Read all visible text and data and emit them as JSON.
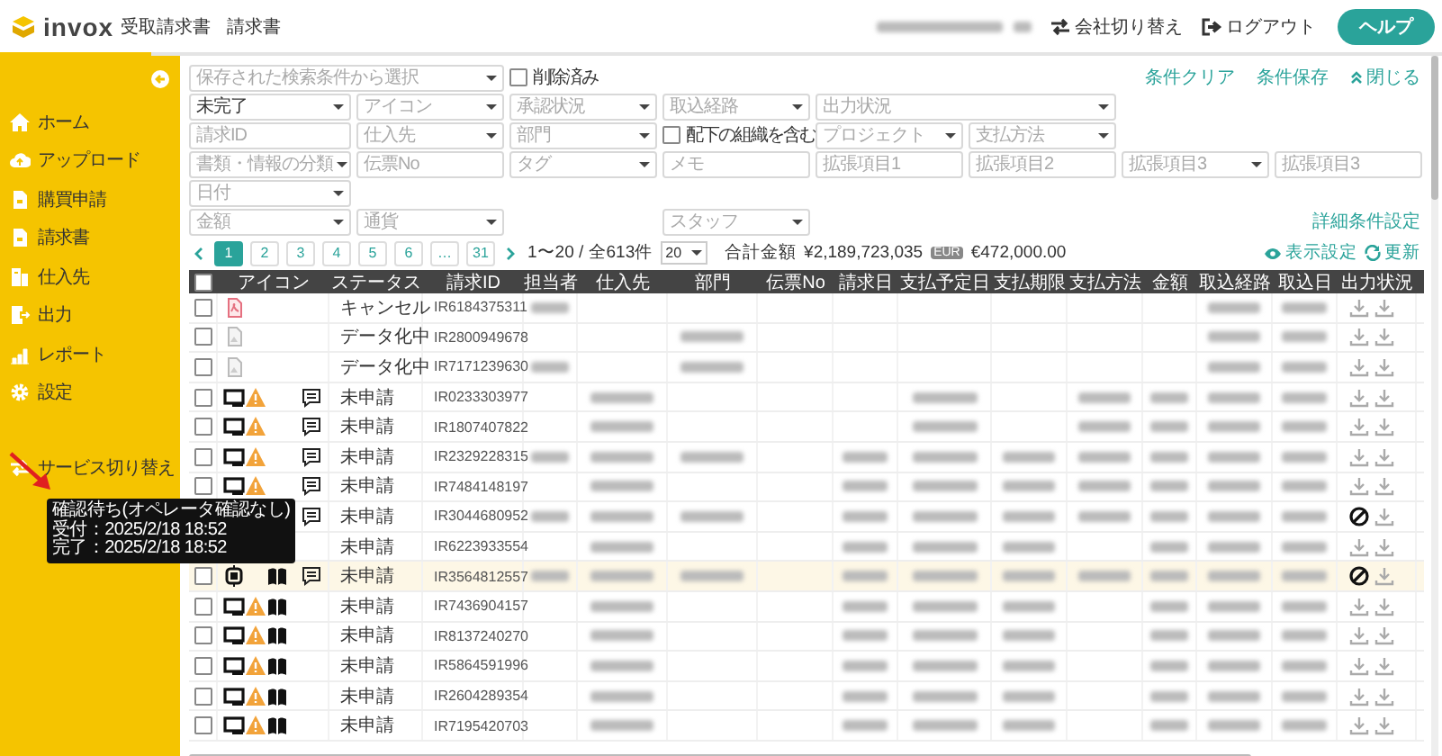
{
  "header": {
    "logo": "invox",
    "product": "受取請求書",
    "breadcrumb": "請求書",
    "actions": [
      {
        "kind": "switch",
        "label": "会社切り替え"
      },
      {
        "kind": "logout",
        "label": "ログアウト"
      }
    ],
    "help": "ヘルプ"
  },
  "sidebar": {
    "items": [
      {
        "kind": "home",
        "label": "ホーム"
      },
      {
        "kind": "upload",
        "label": "アップロード"
      },
      {
        "kind": "doc",
        "label": "購買申請"
      },
      {
        "kind": "doc",
        "label": "請求書"
      },
      {
        "kind": "building",
        "label": "仕入先"
      },
      {
        "kind": "export",
        "label": "出力"
      },
      {
        "kind": "chart",
        "label": "レポート"
      },
      {
        "kind": "gear",
        "label": "設定"
      },
      {
        "kind": "switch",
        "label": "サービス切り替え"
      }
    ]
  },
  "filters": {
    "rows": [
      [
        {
          "kind": "select",
          "placeholder": "保存された検索条件から選択"
        },
        {
          "kind": "checkbox",
          "label": "削除済み",
          "checked": false
        }
      ],
      [
        {
          "kind": "select",
          "value": "未完了"
        },
        {
          "kind": "select",
          "placeholder": "アイコン"
        },
        {
          "kind": "select",
          "placeholder": "承認状況"
        },
        {
          "kind": "select",
          "placeholder": "取込経路"
        },
        {
          "kind": "select",
          "placeholder": "出力状況"
        }
      ],
      [
        {
          "kind": "input",
          "placeholder": "請求ID"
        },
        {
          "kind": "select",
          "placeholder": "仕入先"
        },
        {
          "kind": "select",
          "placeholder": "部門"
        },
        {
          "kind": "checkbox",
          "label": "配下の組織を含む",
          "checked": false
        },
        {
          "kind": "select",
          "placeholder": "プロジェクト"
        },
        {
          "kind": "select",
          "placeholder": "支払方法"
        }
      ],
      [
        {
          "kind": "select",
          "placeholder": "書類・情報の分類"
        },
        {
          "kind": "input",
          "placeholder": "伝票No"
        },
        {
          "kind": "select",
          "placeholder": "タグ"
        },
        {
          "kind": "input",
          "placeholder": "メモ"
        },
        {
          "kind": "input",
          "placeholder": "拡張項目1"
        },
        {
          "kind": "input",
          "placeholder": "拡張項目2"
        },
        {
          "kind": "select",
          "placeholder": "拡張項目3"
        },
        {
          "kind": "input",
          "placeholder": "拡張項目3"
        }
      ],
      [
        {
          "kind": "select",
          "placeholder": "日付"
        }
      ],
      [
        {
          "kind": "select",
          "placeholder": "金額"
        },
        {
          "kind": "select",
          "placeholder": "通貨"
        },
        "",
        {
          "kind": "select",
          "placeholder": "スタッフ"
        }
      ]
    ],
    "links": [
      "条件クリア",
      "条件保存",
      "閉じる"
    ],
    "advanced_link": "詳細条件設定"
  },
  "pagination": {
    "pages": [
      {
        "label": "1",
        "selected": true
      },
      {
        "label": "2",
        "selected": false
      },
      {
        "label": "3",
        "selected": false
      },
      {
        "label": "4",
        "selected": false
      },
      {
        "label": "5",
        "selected": false
      },
      {
        "label": "6",
        "selected": false
      },
      {
        "label": "…",
        "selected": false
      },
      {
        "label": "31",
        "selected": false
      }
    ],
    "range": "1〜20 / 全613件",
    "per_page": "20",
    "total_label": "合計金額",
    "total": "¥2,189,723,035",
    "currency_badge": "EUR",
    "foreign_total": "€472,000.00",
    "display_settings": "表示設定",
    "refresh": "更新"
  },
  "table": {
    "columns": [
      "アイコン",
      "ステータス",
      "請求ID",
      "担当者",
      "仕入先",
      "部門",
      "伝票No",
      "請求日",
      "支払予定日",
      "支払期限",
      "支払方法",
      "金額",
      "取込経路",
      "取込日",
      "出力状況"
    ],
    "all_checked": false,
    "rows": [
      {
        "checked": false,
        "selected": false,
        "kind": "pdf",
        "warning": false,
        "book": false,
        "comment": false,
        "status": "キャンセル",
        "id": "IR6184375311",
        "export_blocked": false
      },
      {
        "checked": false,
        "selected": false,
        "kind": "image",
        "warning": false,
        "book": false,
        "comment": false,
        "status": "データ化中",
        "id": "IR2800949678",
        "export_blocked": false
      },
      {
        "checked": false,
        "selected": false,
        "kind": "image",
        "warning": false,
        "book": false,
        "comment": false,
        "status": "データ化中",
        "id": "IR7171239630",
        "export_blocked": false
      },
      {
        "checked": false,
        "selected": false,
        "kind": "monitor",
        "warning": true,
        "book": false,
        "comment": true,
        "status": "未申請",
        "id": "IR0233303977",
        "export_blocked": false
      },
      {
        "checked": false,
        "selected": false,
        "kind": "monitor",
        "warning": true,
        "book": false,
        "comment": true,
        "status": "未申請",
        "id": "IR1807407822",
        "export_blocked": false
      },
      {
        "checked": false,
        "selected": false,
        "kind": "monitor",
        "warning": true,
        "book": false,
        "comment": true,
        "status": "未申請",
        "id": "IR2329228315",
        "export_blocked": false
      },
      {
        "checked": false,
        "selected": false,
        "kind": "monitor",
        "warning": true,
        "book": false,
        "comment": true,
        "status": "未申請",
        "id": "IR7484148197",
        "export_blocked": false
      },
      {
        "selected": false,
        "comment": true,
        "status": "未申請",
        "id": "IR3044680952",
        "export_blocked": true
      },
      {
        "selected": false,
        "status": "未申請",
        "id": "IR6223933554",
        "export_blocked": false
      },
      {
        "checked": false,
        "selected": true,
        "kind": "chip",
        "warning": false,
        "book": true,
        "comment": true,
        "status": "未申請",
        "id": "IR3564812557",
        "export_blocked": true
      },
      {
        "checked": false,
        "selected": false,
        "kind": "monitor",
        "warning": true,
        "book": true,
        "comment": false,
        "status": "未申請",
        "id": "IR7436904157",
        "export_blocked": false
      },
      {
        "checked": false,
        "selected": false,
        "kind": "monitor",
        "warning": true,
        "book": true,
        "comment": false,
        "status": "未申請",
        "id": "IR8137240270",
        "export_blocked": false
      },
      {
        "checked": false,
        "selected": false,
        "kind": "monitor",
        "warning": true,
        "book": true,
        "comment": false,
        "status": "未申請",
        "id": "IR5864591996",
        "export_blocked": false
      },
      {
        "checked": false,
        "selected": false,
        "kind": "monitor",
        "warning": true,
        "book": true,
        "comment": false,
        "status": "未申請",
        "id": "IR2604289354",
        "export_blocked": false
      },
      {
        "checked": false,
        "selected": false,
        "kind": "monitor",
        "warning": true,
        "book": true,
        "comment": false,
        "status": "未申請",
        "id": "IR7195420703",
        "export_blocked": false
      }
    ]
  },
  "tooltip": {
    "lines": [
      "確認待ち(オペレータ確認なし)",
      "受付：2025/2/18 18:52",
      "完了：2025/2/18 18:52"
    ]
  }
}
